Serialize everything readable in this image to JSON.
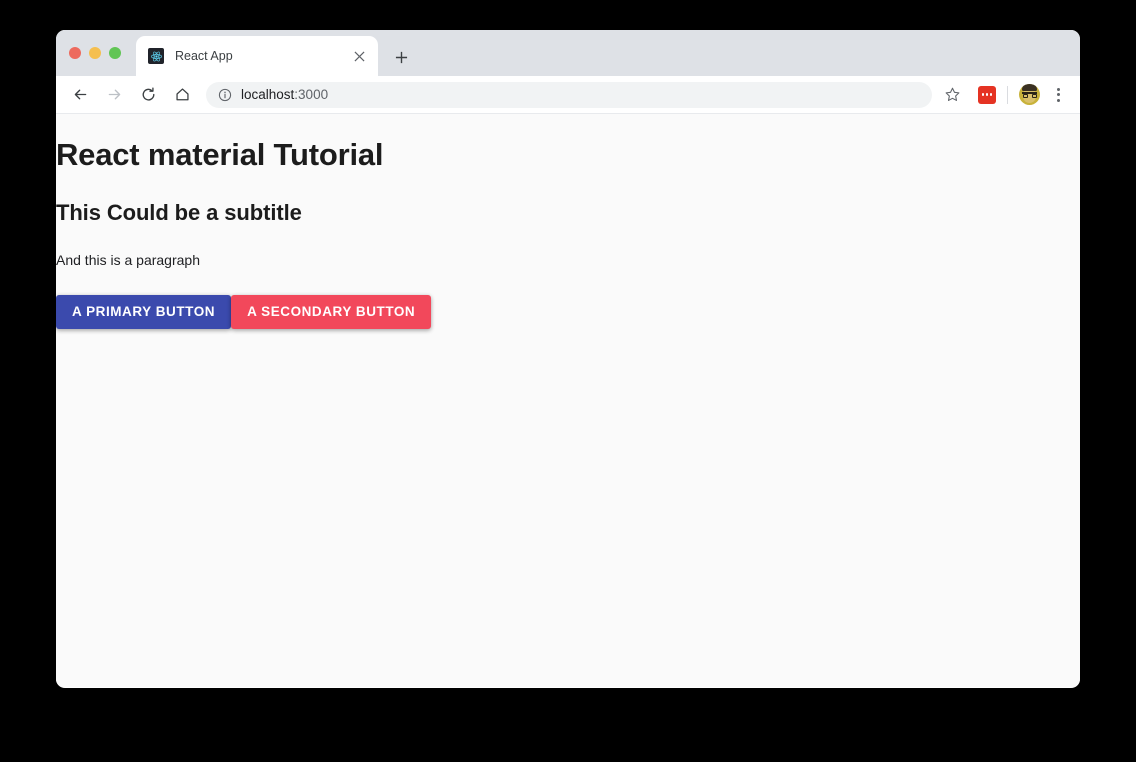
{
  "browser": {
    "window_controls": [
      {
        "name": "close",
        "color": "#ed6a5e"
      },
      {
        "name": "minimize",
        "color": "#f5bf4f"
      },
      {
        "name": "zoom",
        "color": "#61c555"
      }
    ],
    "tab": {
      "title": "React App",
      "favicon": "react-logo-icon",
      "close_label": "✕"
    },
    "new_tab_label": "+",
    "toolbar": {
      "back_icon": "back-arrow-icon",
      "forward_icon": "forward-arrow-icon",
      "reload_icon": "reload-icon",
      "home_icon": "home-icon",
      "security_icon": "info-circle-icon",
      "url_host": "localhost",
      "url_port": ":3000",
      "url_full": "localhost:3000",
      "bookmark_icon": "star-icon",
      "extension_icon": "extension-red-icon",
      "extension_color": "#e53323",
      "avatar_icon": "profile-avatar",
      "menu_icon": "three-dot-menu-icon"
    }
  },
  "page": {
    "title": "React material Tutorial",
    "subtitle": "This Could be a subtitle",
    "paragraph": "And this is a paragraph",
    "buttons": {
      "primary_label": "A PRIMARY BUTTON",
      "primary_color": "#3b4aad",
      "secondary_label": "A SECONDARY BUTTON",
      "secondary_color": "#f2485b"
    }
  }
}
